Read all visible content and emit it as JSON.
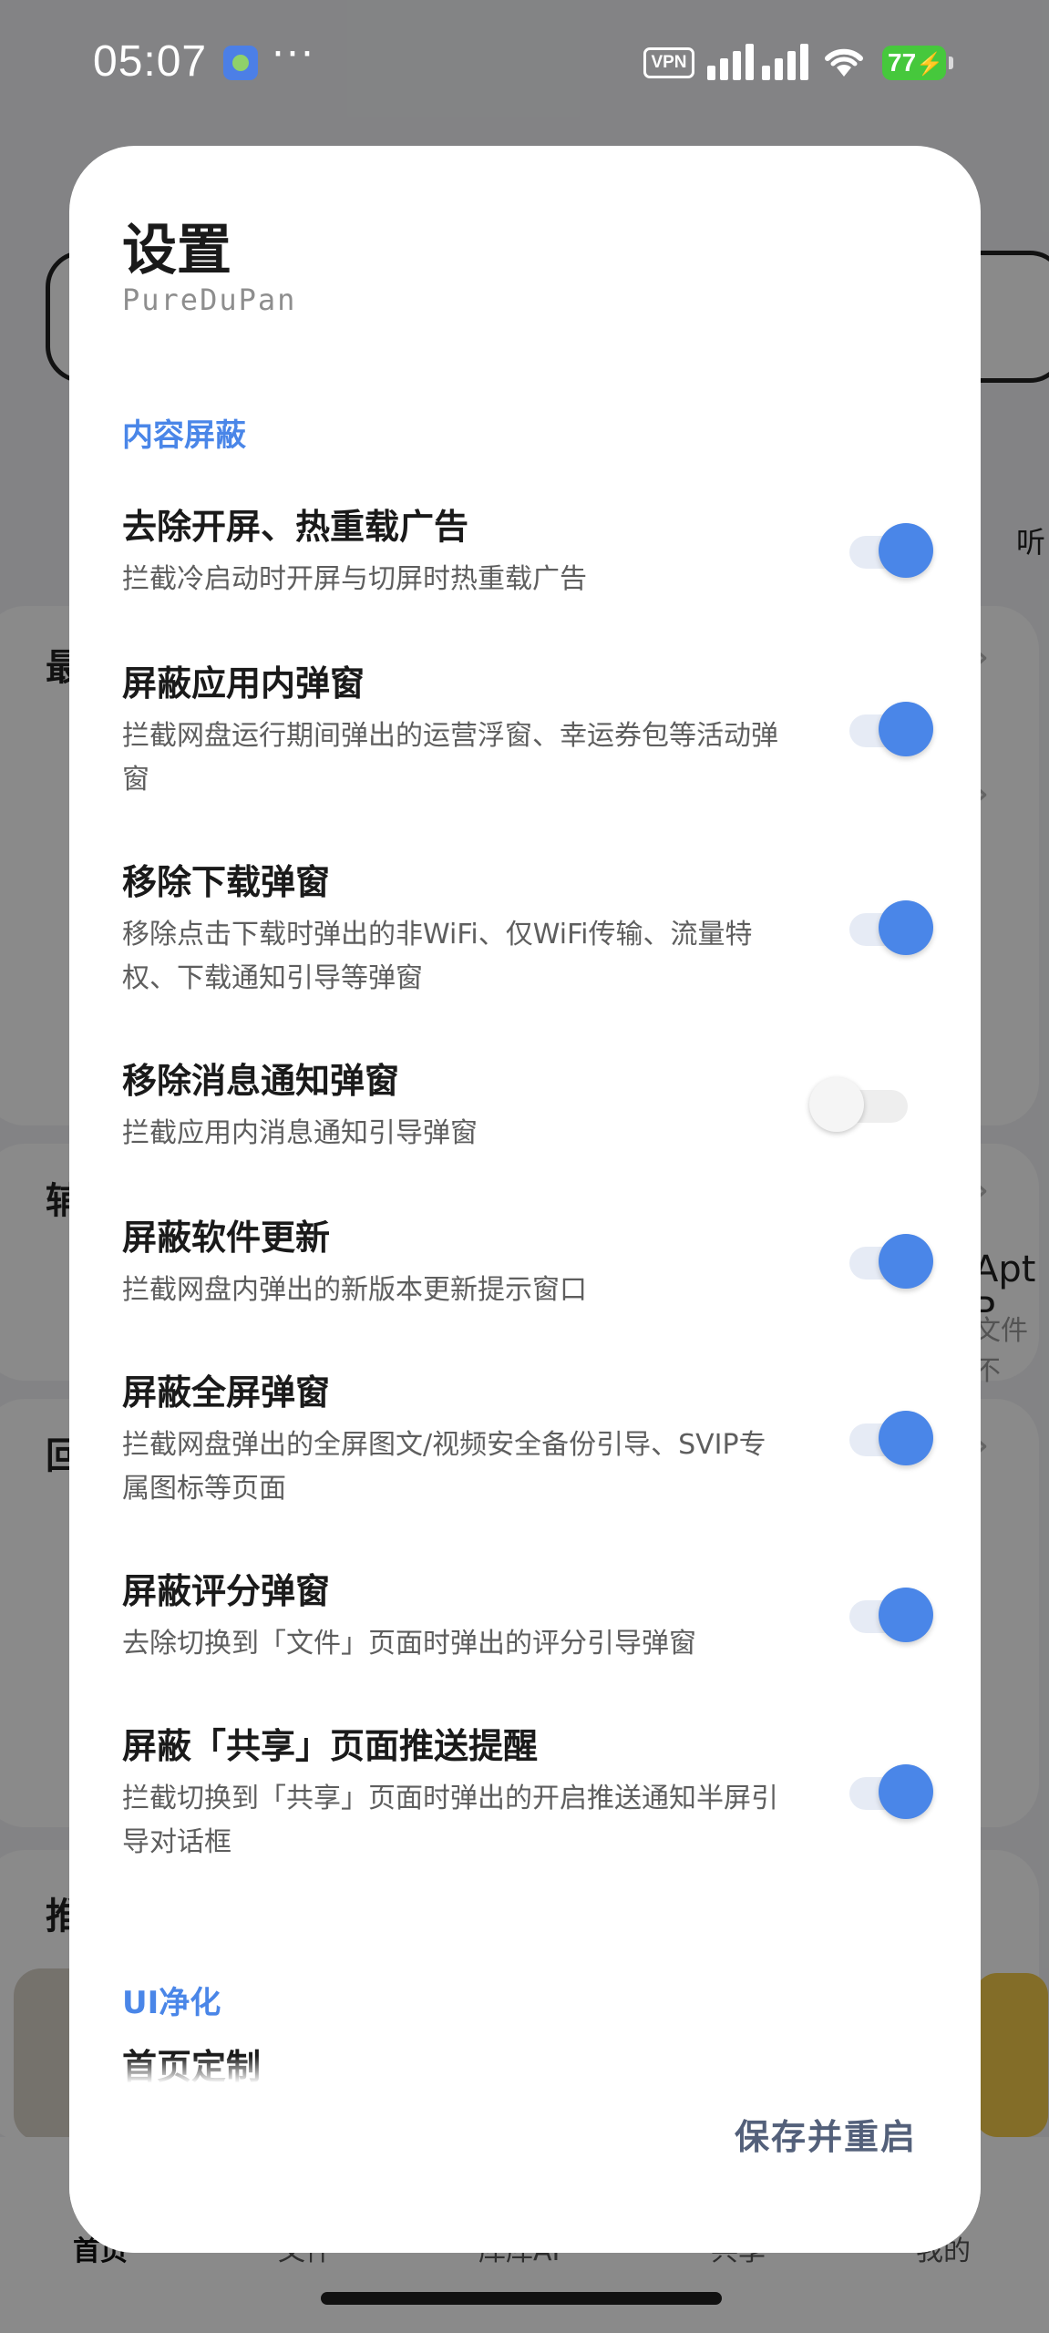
{
  "status_bar": {
    "time": "05:07",
    "more_glyph": "···",
    "vpn": "VPN",
    "battery": "77"
  },
  "background_app": {
    "nav_labels": [
      "首页",
      "文件",
      "库库AI",
      "共享",
      "我的"
    ],
    "partial_labels": {
      "right_icon_text": "听",
      "right_card_title": "Apt P",
      "right_card_sub": "文件不",
      "left_letters": [
        "最",
        "辅",
        "回",
        "推"
      ]
    }
  },
  "dialog": {
    "title": "设置",
    "subtitle": "PureDuPan",
    "sections": [
      {
        "header": "内容屏蔽",
        "items": [
          {
            "title": "去除开屏、热重载广告",
            "desc": "拦截冷启动时开屏与切屏时热重载广告",
            "enabled": true
          },
          {
            "title": "屏蔽应用内弹窗",
            "desc": "拦截网盘运行期间弹出的运营浮窗、幸运券包等活动弹窗",
            "enabled": true
          },
          {
            "title": "移除下载弹窗",
            "desc": "移除点击下载时弹出的非WiFi、仅WiFi传输、流量特权、下载通知引导等弹窗",
            "enabled": true
          },
          {
            "title": "移除消息通知弹窗",
            "desc": "拦截应用内消息通知引导弹窗",
            "enabled": false
          },
          {
            "title": "屏蔽软件更新",
            "desc": "拦截网盘内弹出的新版本更新提示窗口",
            "enabled": true
          },
          {
            "title": "屏蔽全屏弹窗",
            "desc": "拦截网盘弹出的全屏图文/视频安全备份引导、SVIP专属图标等页面",
            "enabled": true
          },
          {
            "title": "屏蔽评分弹窗",
            "desc": "去除切换到「文件」页面时弹出的评分引导弹窗",
            "enabled": true
          },
          {
            "title": "屏蔽「共享」页面推送提醒",
            "desc": "拦截切换到「共享」页面时弹出的开启推送通知半屏引导对话框",
            "enabled": true
          }
        ]
      },
      {
        "header": "UI净化",
        "items": [
          {
            "title": "首页定制"
          }
        ]
      }
    ],
    "save_label": "保存并重启"
  },
  "colors": {
    "accent": "#4a86e8",
    "save_text": "#53607a",
    "battery": "#46c83c"
  }
}
